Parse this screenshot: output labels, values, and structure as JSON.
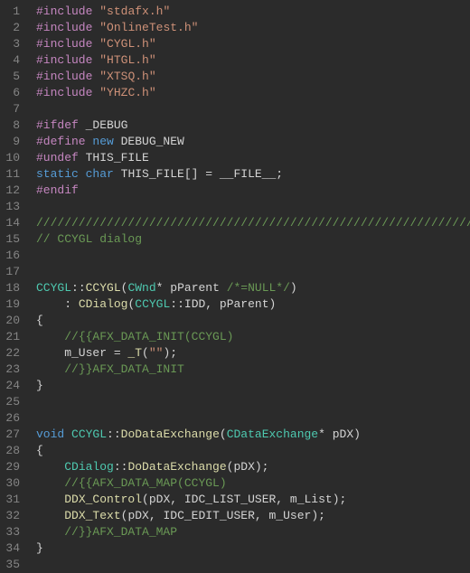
{
  "lines": [
    {
      "num": "1",
      "tokens": [
        [
          "kw-pp",
          "#include"
        ],
        [
          "id",
          " "
        ],
        [
          "str",
          "\"stdafx.h\""
        ]
      ]
    },
    {
      "num": "2",
      "tokens": [
        [
          "kw-pp",
          "#include"
        ],
        [
          "id",
          " "
        ],
        [
          "str",
          "\"OnlineTest.h\""
        ]
      ]
    },
    {
      "num": "3",
      "tokens": [
        [
          "kw-pp",
          "#include"
        ],
        [
          "id",
          " "
        ],
        [
          "str",
          "\"CYGL.h\""
        ]
      ]
    },
    {
      "num": "4",
      "tokens": [
        [
          "kw-pp",
          "#include"
        ],
        [
          "id",
          " "
        ],
        [
          "str",
          "\"HTGL.h\""
        ]
      ]
    },
    {
      "num": "5",
      "tokens": [
        [
          "kw-pp",
          "#include"
        ],
        [
          "id",
          " "
        ],
        [
          "str",
          "\"XTSQ.h\""
        ]
      ]
    },
    {
      "num": "6",
      "tokens": [
        [
          "kw-pp",
          "#include"
        ],
        [
          "id",
          " "
        ],
        [
          "str",
          "\"YHZC.h\""
        ]
      ]
    },
    {
      "num": "7",
      "tokens": []
    },
    {
      "num": "8",
      "tokens": [
        [
          "kw-pp",
          "#ifdef"
        ],
        [
          "id",
          " "
        ],
        [
          "def",
          "_DEBUG"
        ]
      ]
    },
    {
      "num": "9",
      "tokens": [
        [
          "kw-pp",
          "#define"
        ],
        [
          "id",
          " "
        ],
        [
          "macro",
          "new"
        ],
        [
          "id",
          " DEBUG_NEW"
        ]
      ]
    },
    {
      "num": "10",
      "tokens": [
        [
          "kw-pp",
          "#undef"
        ],
        [
          "id",
          " THIS_FILE"
        ]
      ]
    },
    {
      "num": "11",
      "tokens": [
        [
          "kw",
          "static"
        ],
        [
          "id",
          " "
        ],
        [
          "kw",
          "char"
        ],
        [
          "id",
          " THIS_FILE[] = __FILE__;"
        ]
      ]
    },
    {
      "num": "12",
      "tokens": [
        [
          "kw-pp",
          "#endif"
        ]
      ]
    },
    {
      "num": "13",
      "tokens": []
    },
    {
      "num": "14",
      "tokens": [
        [
          "com",
          "/////////////////////////////////////////////////////////////////////////////"
        ]
      ]
    },
    {
      "num": "15",
      "tokens": [
        [
          "com",
          "// CCYGL dialog"
        ]
      ]
    },
    {
      "num": "16",
      "tokens": []
    },
    {
      "num": "17",
      "tokens": []
    },
    {
      "num": "18",
      "tokens": [
        [
          "typ",
          "CCYGL"
        ],
        [
          "op",
          "::"
        ],
        [
          "fn",
          "CCYGL"
        ],
        [
          "op",
          "("
        ],
        [
          "typ",
          "CWnd"
        ],
        [
          "op",
          "*"
        ],
        [
          "id",
          " pParent "
        ],
        [
          "com",
          "/*=NULL*/"
        ],
        [
          "op",
          ")"
        ]
      ]
    },
    {
      "num": "19",
      "tokens": [
        [
          "id",
          "    "
        ],
        [
          "op",
          ":"
        ],
        [
          "id",
          " "
        ],
        [
          "fn",
          "CDialog"
        ],
        [
          "op",
          "("
        ],
        [
          "typ",
          "CCYGL"
        ],
        [
          "op",
          "::"
        ],
        [
          "id",
          "IDD"
        ],
        [
          "op",
          ", "
        ],
        [
          "id",
          "pParent"
        ],
        [
          "op",
          ")"
        ]
      ]
    },
    {
      "num": "20",
      "tokens": [
        [
          "op",
          "{"
        ]
      ]
    },
    {
      "num": "21",
      "tokens": [
        [
          "id",
          "    "
        ],
        [
          "com",
          "//{{AFX_DATA_INIT(CCYGL)"
        ]
      ]
    },
    {
      "num": "22",
      "tokens": [
        [
          "id",
          "    m_User = "
        ],
        [
          "fn",
          "_T"
        ],
        [
          "op",
          "("
        ],
        [
          "str",
          "\"\""
        ],
        [
          "op",
          ");"
        ]
      ]
    },
    {
      "num": "23",
      "tokens": [
        [
          "id",
          "    "
        ],
        [
          "com",
          "//}}AFX_DATA_INIT"
        ]
      ]
    },
    {
      "num": "24",
      "tokens": [
        [
          "op",
          "}"
        ]
      ]
    },
    {
      "num": "25",
      "tokens": []
    },
    {
      "num": "26",
      "tokens": []
    },
    {
      "num": "27",
      "tokens": [
        [
          "kw",
          "void"
        ],
        [
          "id",
          " "
        ],
        [
          "typ",
          "CCYGL"
        ],
        [
          "op",
          "::"
        ],
        [
          "fn",
          "DoDataExchange"
        ],
        [
          "op",
          "("
        ],
        [
          "typ",
          "CDataExchange"
        ],
        [
          "op",
          "*"
        ],
        [
          "id",
          " pDX"
        ],
        [
          "op",
          ")"
        ]
      ]
    },
    {
      "num": "28",
      "tokens": [
        [
          "op",
          "{"
        ]
      ]
    },
    {
      "num": "29",
      "tokens": [
        [
          "id",
          "    "
        ],
        [
          "typ",
          "CDialog"
        ],
        [
          "op",
          "::"
        ],
        [
          "fn",
          "DoDataExchange"
        ],
        [
          "op",
          "("
        ],
        [
          "id",
          "pDX"
        ],
        [
          "op",
          ");"
        ]
      ]
    },
    {
      "num": "30",
      "tokens": [
        [
          "id",
          "    "
        ],
        [
          "com",
          "//{{AFX_DATA_MAP(CCYGL)"
        ]
      ]
    },
    {
      "num": "31",
      "tokens": [
        [
          "id",
          "    "
        ],
        [
          "fn",
          "DDX_Control"
        ],
        [
          "op",
          "("
        ],
        [
          "id",
          "pDX"
        ],
        [
          "op",
          ", "
        ],
        [
          "id",
          "IDC_LIST_USER"
        ],
        [
          "op",
          ", "
        ],
        [
          "id",
          "m_List"
        ],
        [
          "op",
          ");"
        ]
      ]
    },
    {
      "num": "32",
      "tokens": [
        [
          "id",
          "    "
        ],
        [
          "fn",
          "DDX_Text"
        ],
        [
          "op",
          "("
        ],
        [
          "id",
          "pDX"
        ],
        [
          "op",
          ", "
        ],
        [
          "id",
          "IDC_EDIT_USER"
        ],
        [
          "op",
          ", "
        ],
        [
          "id",
          "m_User"
        ],
        [
          "op",
          ");"
        ]
      ]
    },
    {
      "num": "33",
      "tokens": [
        [
          "id",
          "    "
        ],
        [
          "com",
          "//}}AFX_DATA_MAP"
        ]
      ]
    },
    {
      "num": "34",
      "tokens": [
        [
          "op",
          "}"
        ]
      ]
    },
    {
      "num": "35",
      "tokens": []
    }
  ]
}
